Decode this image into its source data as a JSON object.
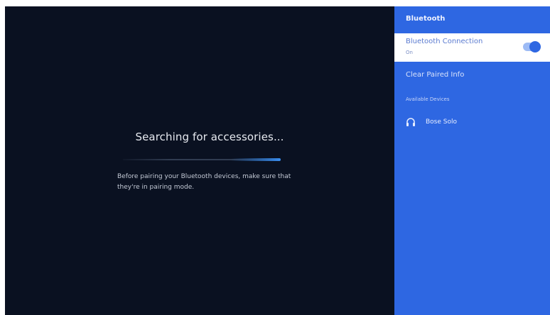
{
  "main": {
    "title": "Searching for accessories...",
    "progress_fraction": 1.0,
    "hint": "Before pairing your Bluetooth devices, make sure that they're in pairing mode."
  },
  "sidebar": {
    "header": "Bluetooth",
    "connection": {
      "label": "Bluetooth Connection",
      "status": "On",
      "enabled": true
    },
    "clear_paired": "Clear Paired Info",
    "available_label": "Available Devices",
    "devices": [
      {
        "name": "Bose Solo",
        "icon": "headphones-icon"
      }
    ]
  },
  "colors": {
    "background": "#0a1121",
    "panel": "#2e67e2",
    "accent": "#3a8ef0"
  }
}
